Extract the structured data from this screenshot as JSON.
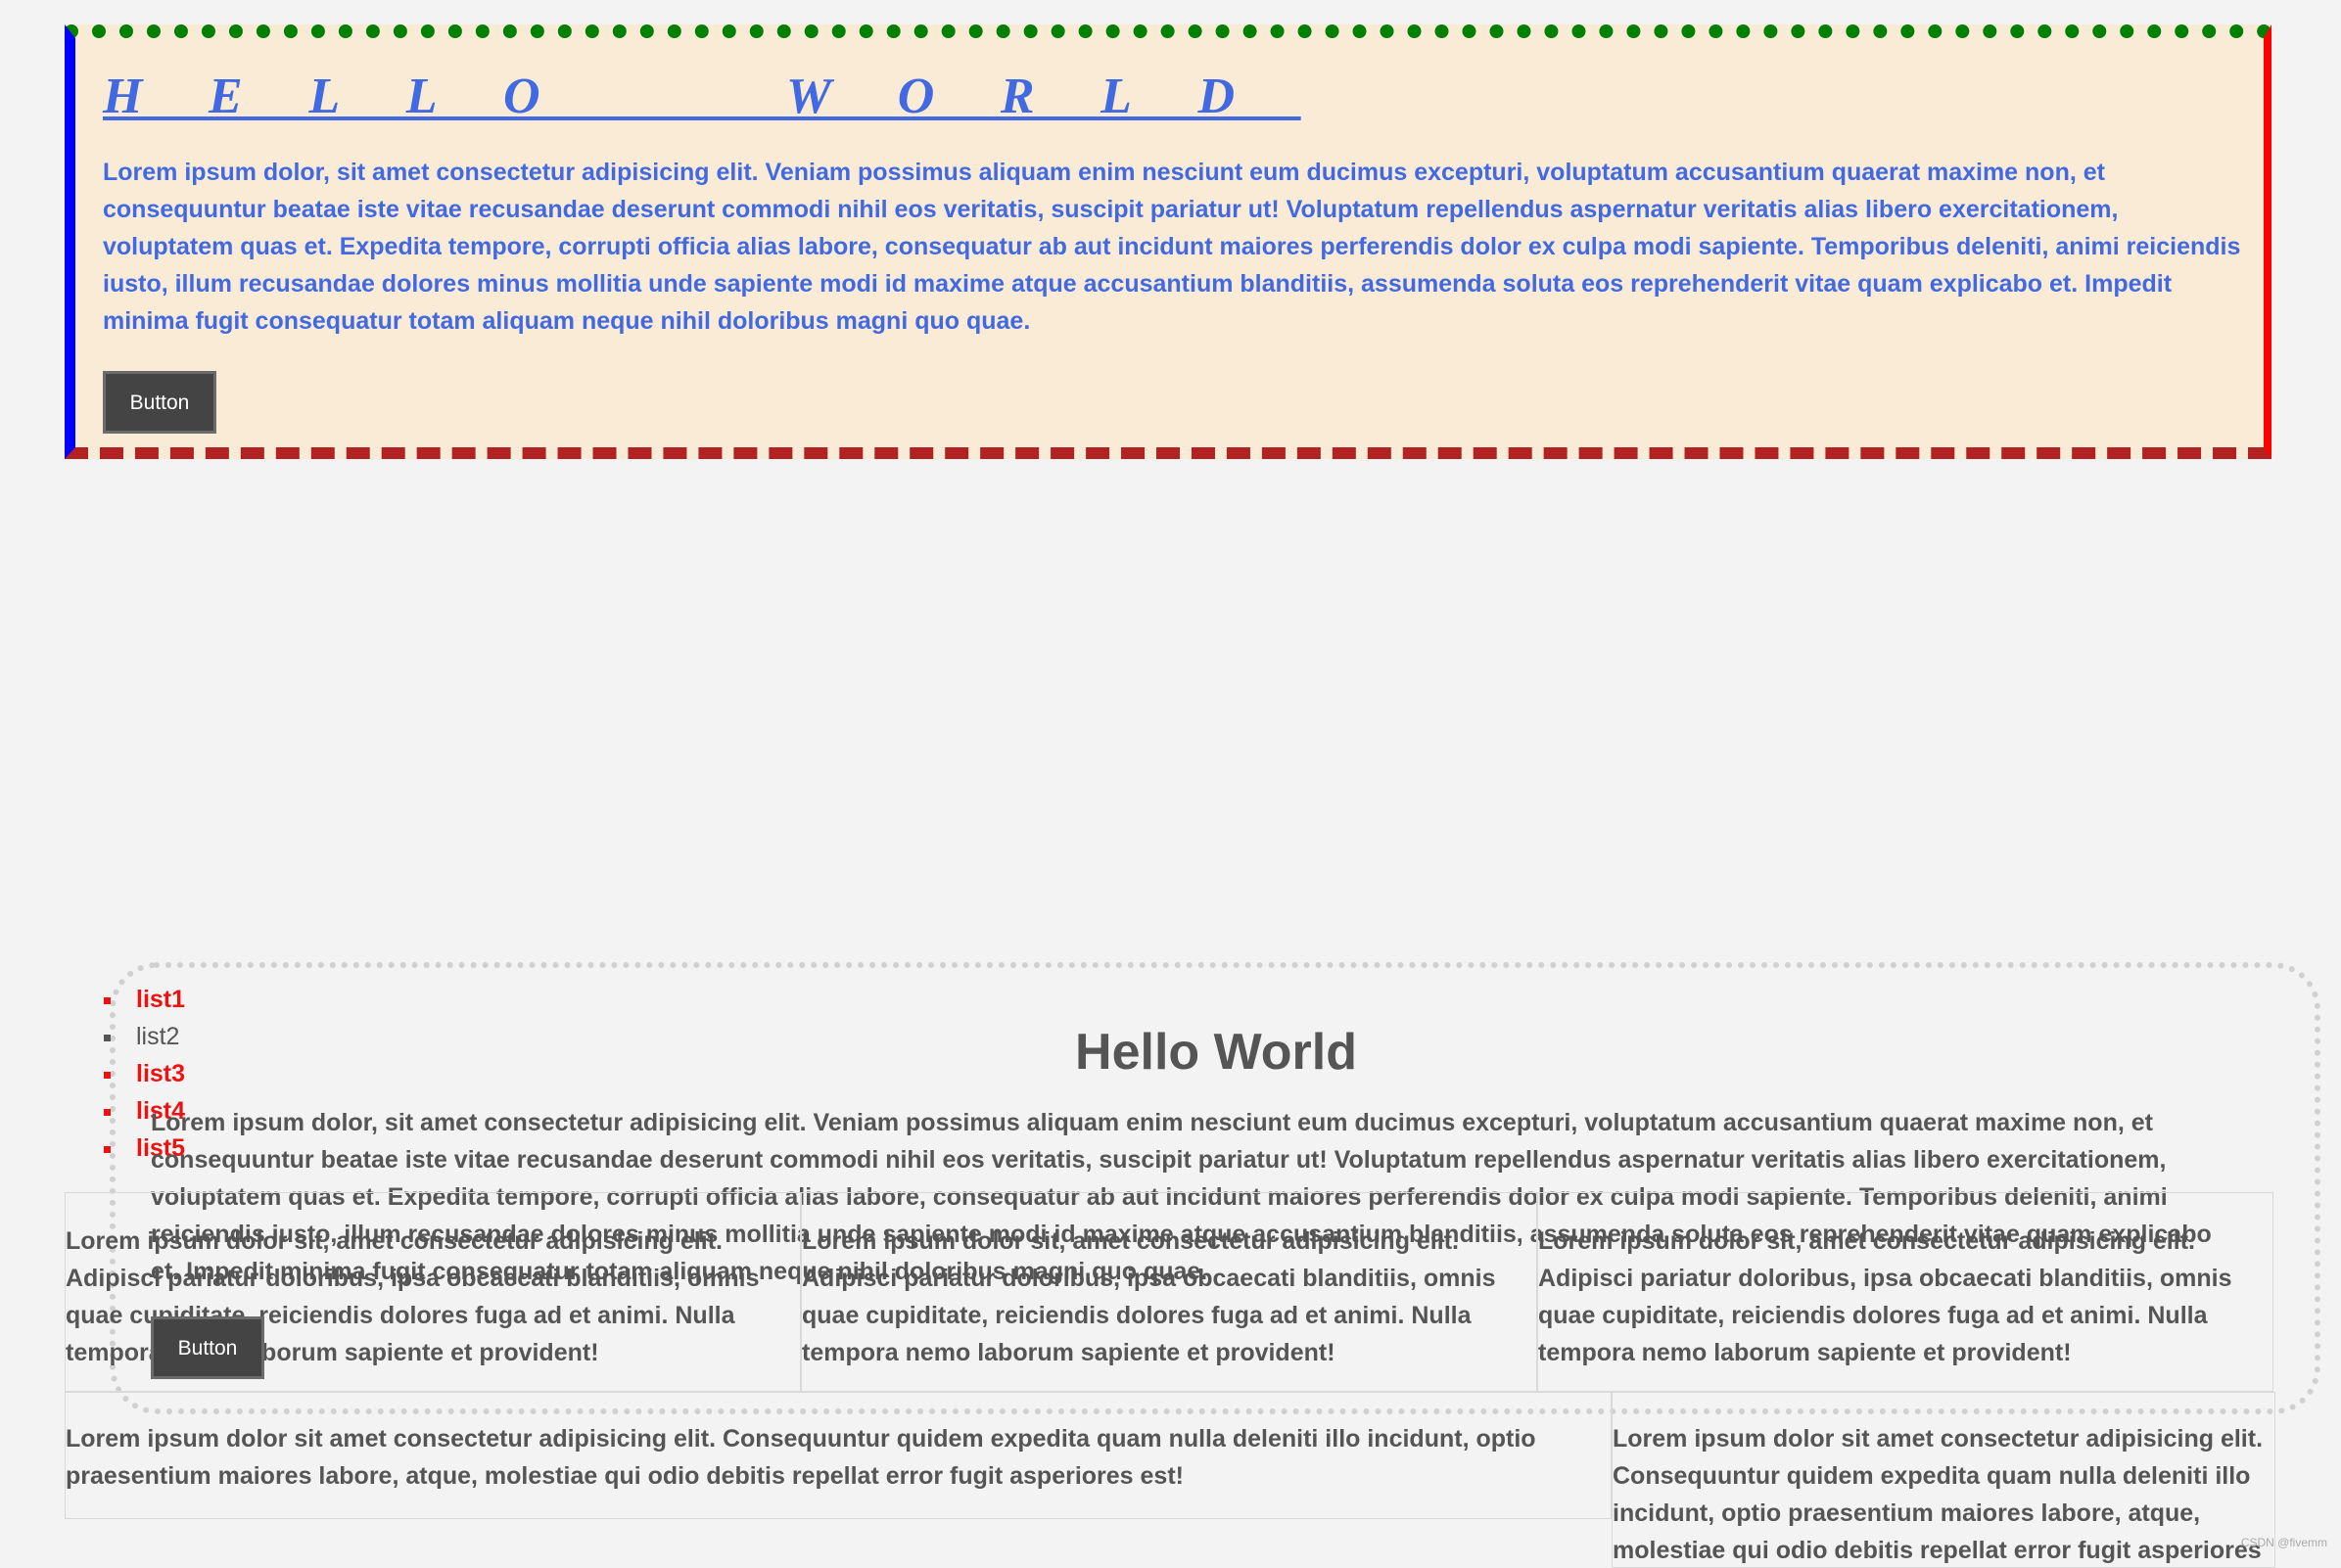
{
  "top": {
    "title": "HELLO WORLD",
    "paragraph": "Lorem ipsum dolor, sit amet consectetur adipisicing elit. Veniam possimus aliquam enim nesciunt eum ducimus excepturi, voluptatum accusantium quaerat maxime non, et consequuntur beatae iste vitae recusandae deserunt commodi nihil eos veritatis, suscipit pariatur ut! Voluptatum repellendus aspernatur veritatis alias libero exercitationem, voluptatem quas et. Expedita tempore, corrupti officia alias labore, consequatur ab aut incidunt maiores perferendis dolor ex culpa modi sapiente. Temporibus deleniti, animi reiciendis iusto, illum recusandae dolores minus mollitia unde sapiente modi id maxime atque accusantium blanditiis, assumenda soluta eos reprehenderit vitae quam explicabo et. Impedit minima fugit consequatur totam aliquam neque nihil doloribus magni quo quae.",
    "button_label": "Button"
  },
  "list": [
    "list1",
    "list2",
    "list3",
    "list4",
    "list5"
  ],
  "bottom": {
    "title": "Hello World",
    "paragraph": "Lorem ipsum dolor, sit amet consectetur adipisicing elit. Veniam possimus aliquam enim nesciunt eum ducimus excepturi, voluptatum accusantium quaerat maxime non, et consequuntur beatae iste vitae recusandae deserunt commodi nihil eos veritatis, suscipit pariatur ut! Voluptatum repellendus aspernatur veritatis alias libero exercitationem, voluptatem quas et. Expedita tempore, corrupti officia alias labore, consequatur ab aut incidunt maiores perferendis dolor ex culpa modi sapiente. Temporibus deleniti, animi reiciendis iusto, illum recusandae dolores minus mollitia unde sapiente modi id maxime atque accusantium blanditiis, assumenda soluta eos reprehenderit vitae quam explicabo et. Impedit minima fugit consequatur totam aliquam neque nihil doloribus magni quo quae.",
    "button_label": "Button"
  },
  "columns": [
    "Lorem ipsum dolor sit, amet consectetur adipisicing elit. Adipisci pariatur doloribus, ipsa obcaecati blanditiis, omnis quae cupiditate, reiciendis dolores fuga ad et animi. Nulla tempora nemo laborum sapiente et provident!",
    "Lorem ipsum dolor sit, amet consectetur adipisicing elit. Adipisci pariatur doloribus, ipsa obcaecati blanditiis, omnis quae cupiditate, reiciendis dolores fuga ad et animi. Nulla tempora nemo laborum sapiente et provident!",
    "Lorem ipsum dolor sit, amet consectetur adipisicing elit. Adipisci pariatur doloribus, ipsa obcaecati blanditiis, omnis quae cupiditate, reiciendis dolores fuga ad et animi. Nulla tempora nemo laborum sapiente et provident!"
  ],
  "row2": [
    "Lorem ipsum dolor sit amet consectetur adipisicing elit. Consequuntur quidem expedita quam nulla deleniti illo incidunt, optio praesentium maiores labore, atque, molestiae qui odio debitis repellat error fugit asperiores est!",
    "Lorem ipsum dolor sit amet consectetur adipisicing elit. Consequuntur quidem expedita quam nulla deleniti illo incidunt, optio praesentium maiores labore, atque, molestiae qui odio debitis repellat error fugit asperiores est!"
  ],
  "watermark": "CSDN @fivemm"
}
